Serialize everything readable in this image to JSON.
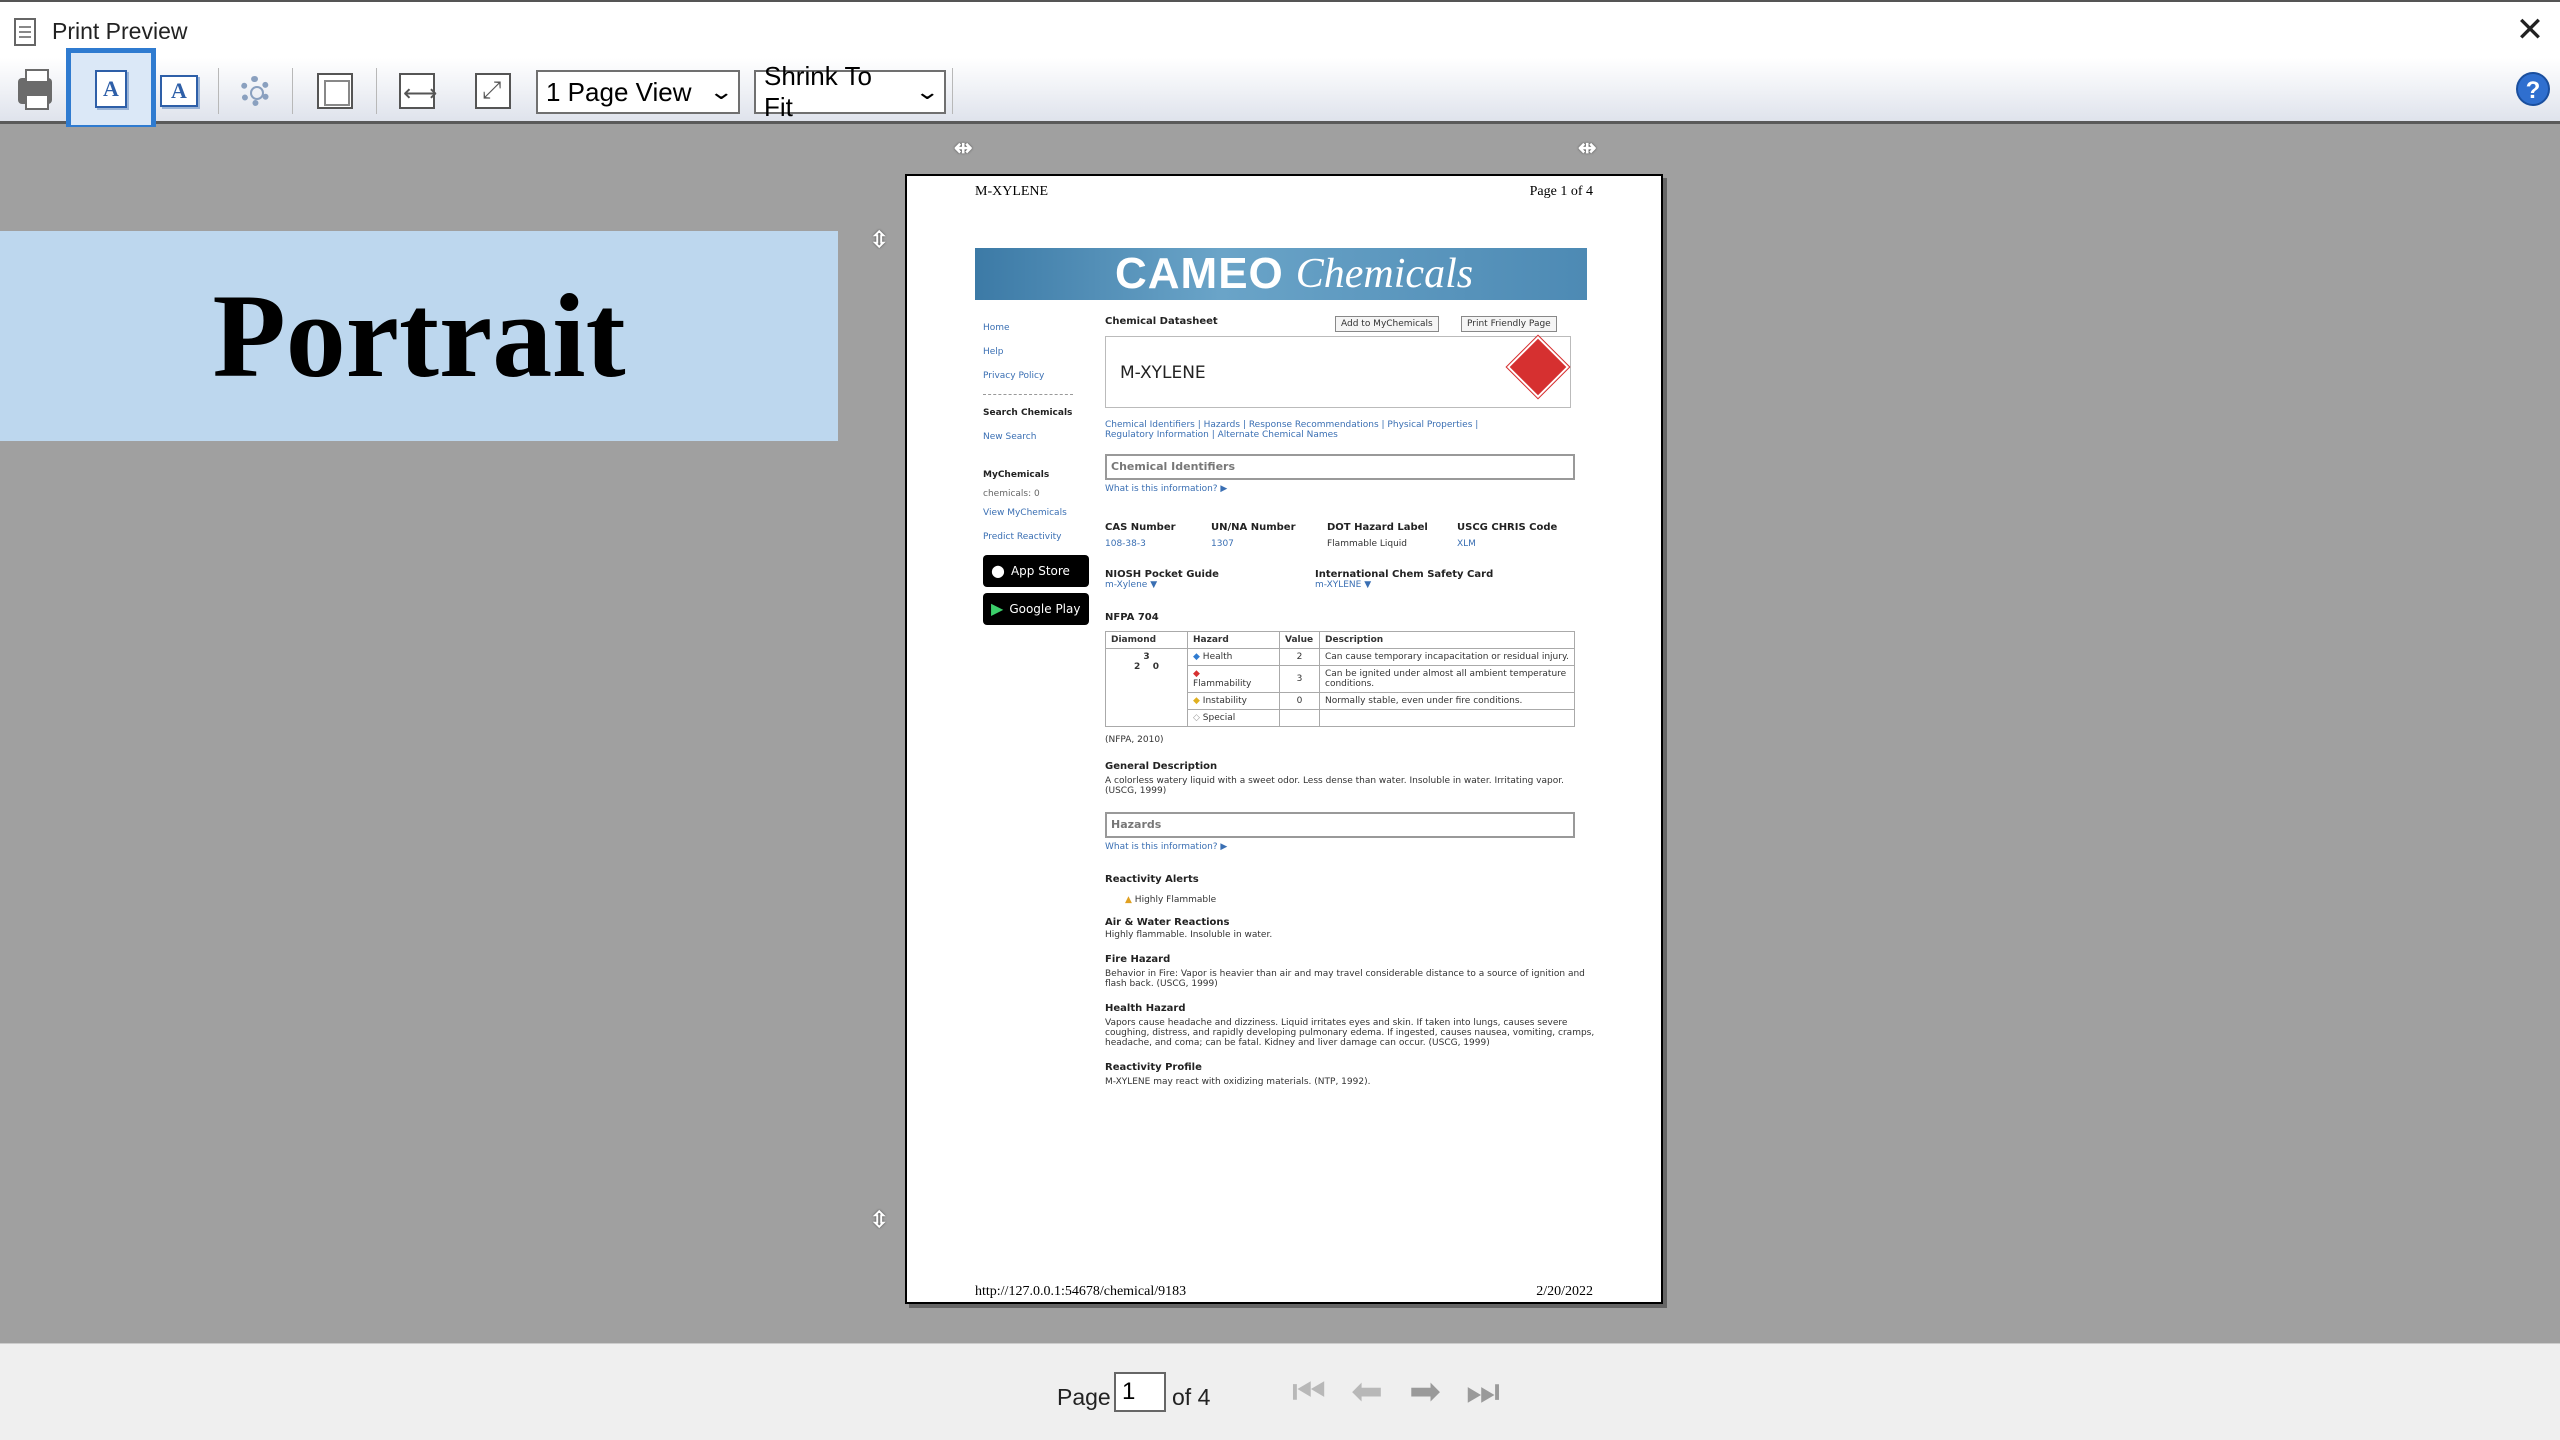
{
  "window": {
    "title": "Print Preview",
    "close_symbol": "✕"
  },
  "toolbar": {
    "page_view": "1 Page View",
    "zoom": "Shrink To Fit",
    "help_symbol": "?"
  },
  "banner": {
    "text": "Portrait"
  },
  "page": {
    "header_left": "M-XYLENE",
    "header_right": "Page 1 of 4",
    "footer_left": "http://127.0.0.1:54678/chemical/9183",
    "footer_right": "2/20/2022",
    "logo_main": "CAMEO",
    "logo_sub": "Chemicals",
    "sidebar": {
      "home": "Home",
      "help": "Help",
      "privacy": "Privacy Policy",
      "search_hdr": "Search Chemicals",
      "new_search": "New Search",
      "mychem_hdr": "MyChemicals",
      "mychem_count": "chemicals: 0",
      "view_mychem": "View MyChemicals",
      "predict": "Predict Reactivity",
      "app_store": "App Store",
      "google_play": "Google Play"
    },
    "datasheet_label": "Chemical Datasheet",
    "add_btn": "Add to MyChemicals",
    "print_btn": "Print Friendly Page",
    "chemical_name": "M-XYLENE",
    "nav_links_1": "Chemical Identifiers | Hazards | Response Recommendations | Physical Properties |",
    "nav_links_2": "Regulatory Information | Alternate Chemical Names",
    "sect_identifiers": "Chemical Identifiers",
    "what_info": "What is this information? ▶",
    "cas_hdr": "CAS Number",
    "cas_val": "108-38-3",
    "un_hdr": "UN/NA Number",
    "un_val": "1307",
    "dot_hdr": "DOT Hazard Label",
    "dot_val": "Flammable Liquid",
    "uscg_hdr": "USCG CHRIS Code",
    "uscg_val": "XLM",
    "niosh_hdr": "NIOSH Pocket Guide",
    "niosh_val": "m-Xylene ▼",
    "icsc_hdr": "International Chem Safety Card",
    "icsc_val": "m-XYLENE ▼",
    "nfpa_hdr": "NFPA 704",
    "nfpa_cols": [
      "Diamond",
      "Hazard",
      "Value",
      "Description"
    ],
    "nfpa_rows": [
      {
        "hazard": "Health",
        "value": "2",
        "desc": "Can cause temporary incapacitation or residual injury."
      },
      {
        "hazard": "Flammability",
        "value": "3",
        "desc": "Can be ignited under almost all ambient temperature conditions."
      },
      {
        "hazard": "Instability",
        "value": "0",
        "desc": "Normally stable, even under fire conditions."
      },
      {
        "hazard": "Special",
        "value": "",
        "desc": ""
      }
    ],
    "diamond_top": "3",
    "diamond_left": "2",
    "diamond_right": "0",
    "nfpa_year": "(NFPA, 2010)",
    "gen_desc_hdr": "General Description",
    "gen_desc": "A colorless watery liquid with a sweet odor. Less dense than water. Insoluble in water. Irritating vapor. (USCG, 1999)",
    "sect_hazards": "Hazards",
    "react_alerts_hdr": "Reactivity Alerts",
    "react_alerts": "Highly Flammable",
    "air_water_hdr": "Air & Water Reactions",
    "air_water": "Highly flammable. Insoluble in water.",
    "fire_hdr": "Fire Hazard",
    "fire": "Behavior in Fire: Vapor is heavier than air and may travel considerable distance to a source of ignition and flash back. (USCG, 1999)",
    "health_hdr": "Health Hazard",
    "health": "Vapors cause headache and dizziness. Liquid irritates eyes and skin. If taken into lungs, causes severe coughing, distress, and rapidly developing pulmonary edema. If ingested, causes nausea, vomiting, cramps, headache, and coma; can be fatal. Kidney and liver damage can occur. (USCG, 1999)",
    "react_profile_hdr": "Reactivity Profile",
    "react_profile": "M-XYLENE may react with oxidizing materials. (NTP, 1992)."
  },
  "pager": {
    "label": "Page",
    "current": "1",
    "of_total": "of 4"
  }
}
